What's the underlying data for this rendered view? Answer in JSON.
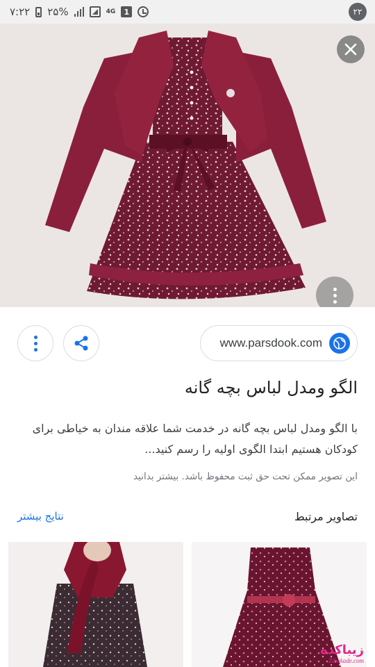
{
  "status_bar": {
    "time": "۷:۲۲",
    "battery": "۲۵%",
    "network": "4G",
    "sim": "1",
    "notification_count": "۲۲"
  },
  "hero": {
    "image_alt": "dress",
    "colors": {
      "dress": "#7b1d36",
      "pattern_dots": "#e8c9cf",
      "background": "#ebe6e4"
    }
  },
  "actions": {
    "site_url": "www.parsdook.com"
  },
  "result": {
    "title": "الگو ومدل لباس بچه گانه",
    "description": "با الگو ومدل لباس بچه گانه در خدمت شما علاقه مندان به خیاطی برای کودکان هستیم ابتدا الگوی اولیه را رسم کنید...",
    "copyright_notice": "این تصویر ممکن تحت حق ثبت محفوظ باشد. بیشتر بدانید"
  },
  "related": {
    "title": "تصاویر مرتبط",
    "more_link": "نتایج بیشتر"
  },
  "watermark": {
    "main": "زیباکده",
    "sub": "Zibakade.com"
  },
  "accent": "#1a73e8"
}
